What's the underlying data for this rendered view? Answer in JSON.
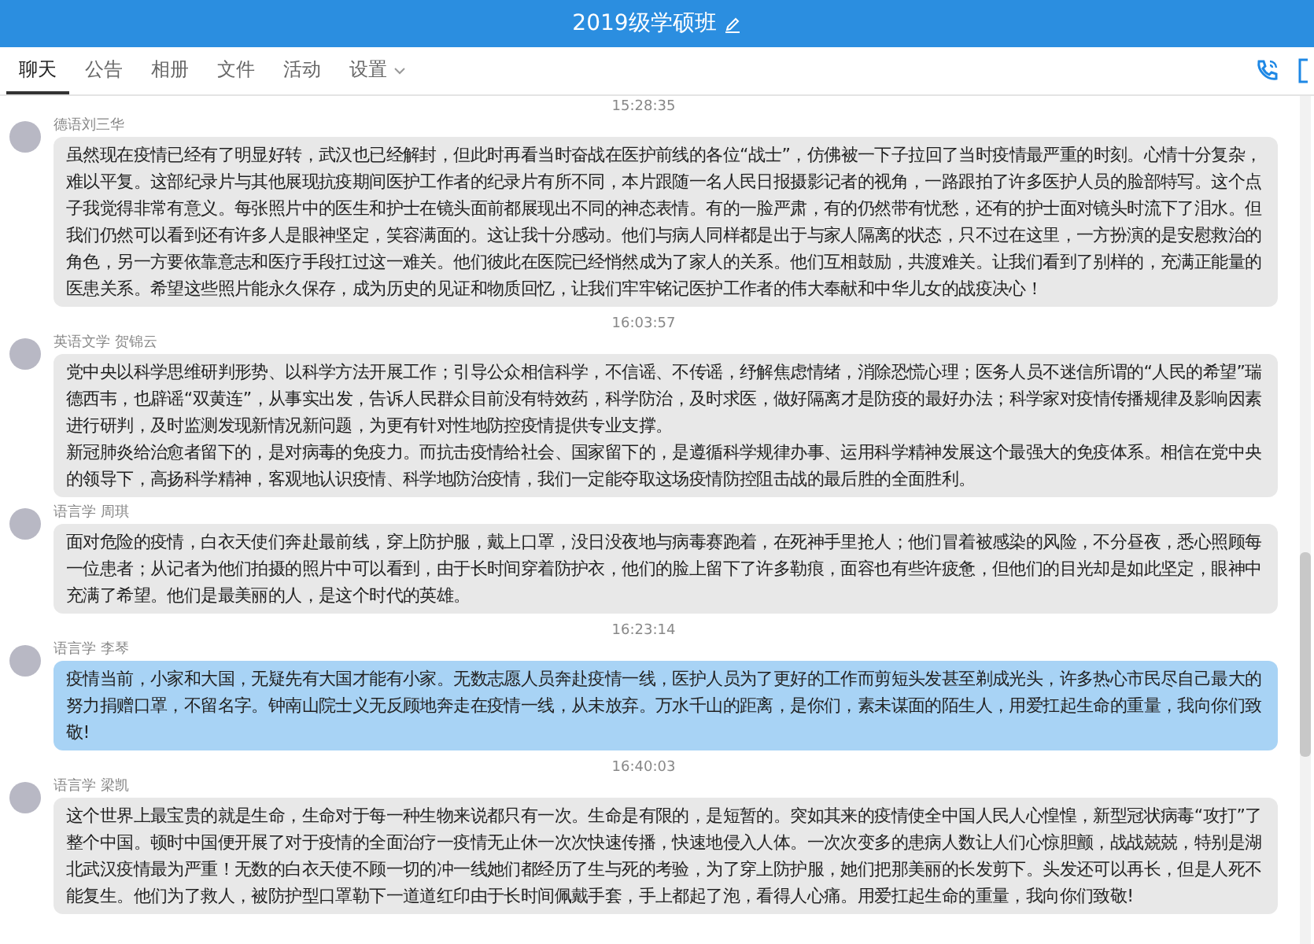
{
  "window": {
    "title": "2019级学硕班"
  },
  "tabs": [
    {
      "label": "聊天",
      "selected": true,
      "dropdown": false
    },
    {
      "label": "公告",
      "selected": false,
      "dropdown": false
    },
    {
      "label": "相册",
      "selected": false,
      "dropdown": false
    },
    {
      "label": "文件",
      "selected": false,
      "dropdown": false
    },
    {
      "label": "活动",
      "selected": false,
      "dropdown": false
    },
    {
      "label": "设置",
      "selected": false,
      "dropdown": true
    }
  ],
  "messages": [
    {
      "time": "15:28:35",
      "sender": "德语刘三华",
      "selected": false,
      "text": "虽然现在疫情已经有了明显好转，武汉也已经解封，但此时再看当时奋战在医护前线的各位“战士”，仿佛被一下子拉回了当时疫情最严重的时刻。心情十分复杂，难以平复。这部纪录片与其他展现抗疫期间医护工作者的纪录片有所不同，本片跟随一名人民日报摄影记者的视角，一路跟拍了许多医护人员的脸部特写。这个点子我觉得非常有意义。每张照片中的医生和护士在镜头面前都展现出不同的神态表情。有的一脸严肃，有的仍然带有忧愁，还有的护士面对镜头时流下了泪水。但我们仍然可以看到还有许多人是眼神坚定，笑容满面的。这让我十分感动。他们与病人同样都是出于与家人隔离的状态，只不过在这里，一方扮演的是安慰救治的角色，另一方要依靠意志和医疗手段扛过这一难关。他们彼此在医院已经悄然成为了家人的关系。他们互相鼓励，共渡难关。让我们看到了别样的，充满正能量的医患关系。希望这些照片能永久保存，成为历史的见证和物质回忆，让我们牢牢铭记医护工作者的伟大奉献和中华儿女的战疫决心！"
    },
    {
      "time": "16:03:57",
      "sender": "英语文学 贺锦云",
      "selected": false,
      "paragraphs": [
        "党中央以科学思维研判形势、以科学方法开展工作；引导公众相信科学，不信谣、不传谣，纾解焦虑情绪，消除恐慌心理；医务人员不迷信所谓的“人民的希望”瑞德西韦，也辟谣“双黄连”，从事实出发，告诉人民群众目前没有特效药，科学防治，及时求医，做好隔离才是防疫的最好办法；科学家对疫情传播规律及影响因素进行研判，及时监测发现新情况新问题，为更有针对性地防控疫情提供专业支撑。",
        "新冠肺炎给治愈者留下的，是对病毒的免疫力。而抗击疫情给社会、国家留下的，是遵循科学规律办事、运用科学精神发展这个最强大的免疫体系。相信在党中央的领导下，高扬科学精神，客观地认识疫情、科学地防治疫情，我们一定能夺取这场疫情防控阻击战的最后胜的全面胜利。"
      ]
    },
    {
      "sender": "语言学 周琪",
      "selected": false,
      "text": "面对危险的疫情，白衣天使们奔赴最前线，穿上防护服，戴上口罩，没日没夜地与病毒赛跑着，在死神手里抢人；他们冒着被感染的风险，不分昼夜，悉心照顾每一位患者；从记者为他们拍摄的照片中可以看到，由于长时间穿着防护衣，他们的脸上留下了许多勒痕，面容也有些许疲惫，但他们的目光却是如此坚定，眼神中充满了希望。他们是最美丽的人，是这个时代的英雄。"
    },
    {
      "time": "16:23:14",
      "sender": "语言学 李琴",
      "selected": true,
      "text": "疫情当前，小家和大国，无疑先有大国才能有小家。无数志愿人员奔赴疫情一线，医护人员为了更好的工作而剪短头发甚至剃成光头，许多热心市民尽自己最大的努力捐赠口罩，不留名字。钟南山院士义无反顾地奔走在疫情一线，从未放弃。万水千山的距离，是你们，素未谋面的陌生人，用爱扛起生命的重量，我向你们致敬!"
    },
    {
      "time": "16:40:03",
      "sender": "语言学 梁凯",
      "selected": false,
      "text": "这个世界上最宝贵的就是生命，生命对于每一种生物来说都只有一次。生命是有限的，是短暂的。突如其来的疫情使全中国人民人心惶惶，新型冠状病毒“攻打”了整个中国。顿时中国便开展了对于疫情的全面治疗一疫情无止休一次次快速传播，快速地侵入人体。一次次变多的患病人数让人们心惊胆颤，战战兢兢，特别是湖北武汉疫情最为严重！无数的白衣天使不顾一切的冲一线她们都经历了生与死的考验，为了穿上防护服，她们把那美丽的长发剪下。头发还可以再长，但是人死不能复生。他们为了救人，被防护型口罩勒下一道道红印由于长时间佩戴手套，手上都起了泡，看得人心痛。用爱扛起生命的重量，我向你们致敬!"
    }
  ]
}
